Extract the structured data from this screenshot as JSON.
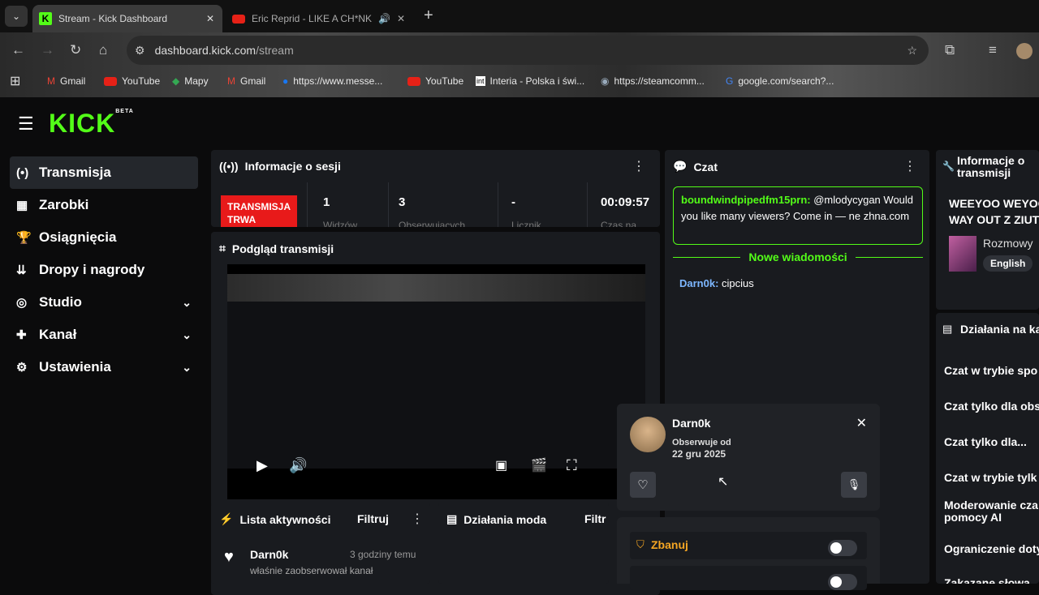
{
  "browser": {
    "tabs": [
      {
        "title": "Stream - Kick Dashboard"
      },
      {
        "title": "Eric Reprid - LIKE A CH*NK"
      }
    ],
    "url_host": "dashboard.kick.com",
    "url_path": "/stream",
    "bookmarks": [
      "Gmail",
      "YouTube",
      "Mapy",
      "Gmail",
      "https://www.messe...",
      "YouTube",
      "Interia - Polska i świ...",
      "https://steamcomm...",
      "google.com/search?..."
    ]
  },
  "logo": {
    "text": "KICK",
    "beta": "BETA"
  },
  "sidebar": {
    "items": [
      {
        "label": "Transmisja",
        "icon": "broadcast-icon"
      },
      {
        "label": "Zarobki",
        "icon": "earnings-icon"
      },
      {
        "label": "Osiągnięcia",
        "icon": "trophy-icon"
      },
      {
        "label": "Dropy i nagrody",
        "icon": "drops-icon"
      },
      {
        "label": "Studio",
        "icon": "studio-icon"
      },
      {
        "label": "Kanał",
        "icon": "channel-icon"
      },
      {
        "label": "Ustawienia",
        "icon": "gear-icon"
      }
    ]
  },
  "session": {
    "title": "Informacje o sesji",
    "status_line1": "TRANSMISJA",
    "status_line2": "TRWA",
    "stats": [
      {
        "value": "1",
        "label": "Widzów"
      },
      {
        "value": "3",
        "label": "Obserwujących"
      },
      {
        "value": "-",
        "label": "Licznik"
      },
      {
        "value": "00:09:57",
        "label": "Czas na..."
      }
    ]
  },
  "preview": {
    "title": "Podgląd transmisji"
  },
  "activity": {
    "title": "Lista aktywności",
    "filter": "Filtruj",
    "user": "Darn0k",
    "time": "3 godziny temu",
    "action": "właśnie zaobserwował kanał"
  },
  "mod": {
    "title": "Działania moda",
    "filter": "Filtr"
  },
  "chat": {
    "title": "Czat",
    "pinned_user": "boundwindpipedfm15prn:",
    "pinned_mention": "@mlodycygan",
    "pinned_text": "Would you like many viewers? Come in — ne zhna.com",
    "new_messages": "Nowe wiadomości",
    "msg_user": "Darn0k:",
    "msg_text": "cipcius"
  },
  "user_card": {
    "name": "Darn0k",
    "follow_label": "Obserwuje od",
    "follow_date": "22 gru 2025",
    "ban_label": "Zbanuj"
  },
  "stream_info": {
    "title_line1": "Informacje o",
    "title_line2": "transmisji",
    "stream_title": "WEEYOO WEYOO WAY OUT Z ZIUT",
    "category": "Rozmowy",
    "tag": "English"
  },
  "channel_actions": {
    "title": "Działania na kanale",
    "items": [
      "Czat w trybie spo",
      "Czat tylko dla obs",
      "Czat tylko dla...",
      "Czat w trybie tylk",
      "Moderowanie cza pomocy AI",
      "Ograniczenie doty",
      "Zakazane słowa"
    ]
  }
}
